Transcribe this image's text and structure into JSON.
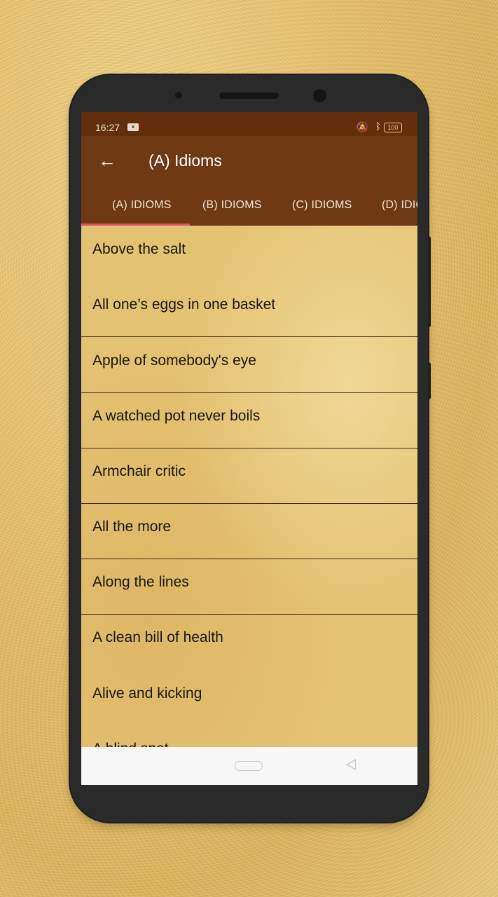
{
  "status_bar": {
    "time": "16:27",
    "notification_icon": "x-notification-icon",
    "mute_icon": "notifications-off-icon",
    "bluetooth_icon": "bluetooth-icon",
    "battery": "100"
  },
  "app_bar": {
    "back_icon": "←",
    "title": "(A) Idioms"
  },
  "tabs": [
    {
      "label": "(A) IDIOMS",
      "selected": true
    },
    {
      "label": "(B) IDIOMS",
      "selected": false
    },
    {
      "label": "(C) IDIOMS",
      "selected": false
    },
    {
      "label": "(D) IDIOMS",
      "selected": false
    }
  ],
  "idioms": [
    "Above the salt",
    "All one’s eggs in one basket",
    "Apple of somebody's eye",
    "A watched pot never boils",
    "Armchair critic",
    "All the more",
    "Along the lines",
    "A clean bill of health",
    "Alive and kicking",
    "A blind spot"
  ],
  "colors": {
    "status_bar": "#622e0b",
    "app_bar": "#6e3a16",
    "tab_indicator": "#e05461",
    "list_background": "#e4c273",
    "divider": "#3e2a15"
  }
}
